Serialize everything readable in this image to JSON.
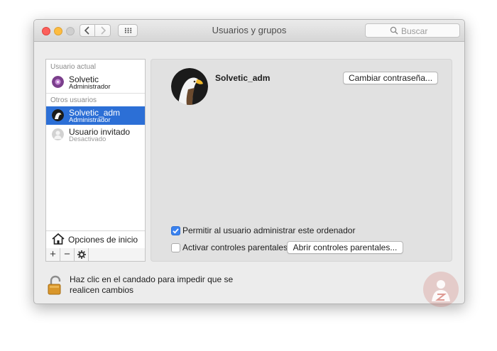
{
  "window": {
    "title": "Usuarios y grupos"
  },
  "search": {
    "placeholder": "Buscar"
  },
  "sidebar": {
    "current_section": "Usuario actual",
    "current_user": {
      "name": "Solvetic",
      "role": "Administrador"
    },
    "others_section": "Otros usuarios",
    "other_users": [
      {
        "name": "Solvetic_adm",
        "role": "Administrador",
        "selected": true
      },
      {
        "name": "Usuario invitado",
        "role": "Desactivado",
        "selected": false
      }
    ],
    "login_options": "Opciones de inicio",
    "buttons": {
      "add": "+",
      "remove": "−",
      "actions": "✱"
    }
  },
  "detail": {
    "username": "Solvetic_adm",
    "change_password_label": "Cambiar contraseña...",
    "allow_admin": {
      "label": "Permitir al usuario administrar este ordenador",
      "checked": true
    },
    "parental": {
      "label": "Activar controles parentales",
      "checked": false
    },
    "open_parental_label": "Abrir controles parentales..."
  },
  "footer": {
    "lock_text": "Haz clic en el candado para impedir que se realicen cambios"
  },
  "colors": {
    "selection": "#2c6fd6",
    "checkbox_on": "#3b82ef",
    "watermark": "#c0392b"
  },
  "icons": [
    "back-chevron-icon",
    "forward-chevron-icon",
    "grid-icon",
    "search-icon",
    "house-icon",
    "gear-icon",
    "lock-icon",
    "eagle-avatar-icon"
  ]
}
